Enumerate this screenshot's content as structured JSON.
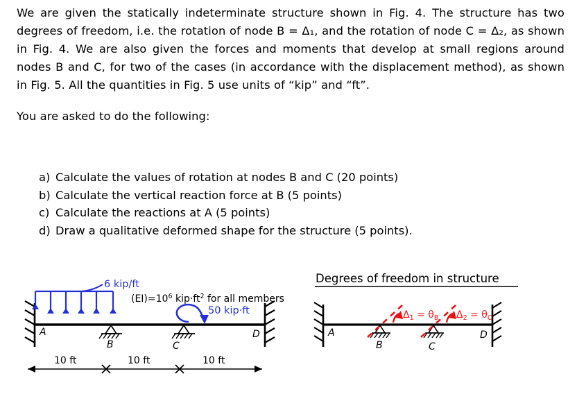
{
  "prose": {
    "intro": "We are given the statically indeterminate structure shown in Fig. 4. The structure has two degrees of freedom, i.e. the rotation of node B = Δ₁, and the rotation of node C = Δ₂, as shown in Fig. 4. We are also given the forces and moments that develop at small regions around nodes B and C, for two of the cases (in accordance with the displacement method), as shown in Fig. 5. All the quantities in Fig. 5 use units of “kip” and “ft”.",
    "lead_in": "You are asked to do the following:"
  },
  "tasks": [
    {
      "marker": "a)",
      "text": "Calculate the values of rotation at nodes B and C (20 points)"
    },
    {
      "marker": "b)",
      "text": "Calculate the vertical reaction force at B (5 points)"
    },
    {
      "marker": "c)",
      "text": "Calculate the reactions at A (5 points)"
    },
    {
      "marker": "d)",
      "text": "Draw a qualitative deformed shape for the structure (5 points)."
    }
  ],
  "figure_left": {
    "distributed_load_label": "6 kip/ft",
    "stiffness_label_prefix": "(EI)",
    "stiffness_label_equals": "=10",
    "stiffness_label_exponent": "6",
    "stiffness_label_units_a": " kip·ft",
    "stiffness_label_units_exp": "2",
    "stiffness_label_units_b": " for all members",
    "moment_label": "50 kip·ft",
    "node_a": "A",
    "node_b": "B",
    "node_c": "C",
    "node_d": "D",
    "span_1": "10 ft",
    "span_2": "10 ft",
    "span_3": "10 ft",
    "arrow_count": 6
  },
  "figure_right": {
    "title": "Degrees of freedom in structure",
    "node_a": "A",
    "node_b": "B",
    "node_c": "C",
    "node_d": "D",
    "dof1_delta": "Δ",
    "dof1_delta_sub": "1",
    "dof1_eq": " = θ",
    "dof1_theta_sub": "B",
    "dof2_delta": "Δ",
    "dof2_delta_sub": "2",
    "dof2_eq": " = θ",
    "dof2_theta_sub": "C"
  },
  "colors": {
    "load_blue": "#2330d8",
    "dof_red": "#ee1111",
    "beam_black": "#000000"
  }
}
